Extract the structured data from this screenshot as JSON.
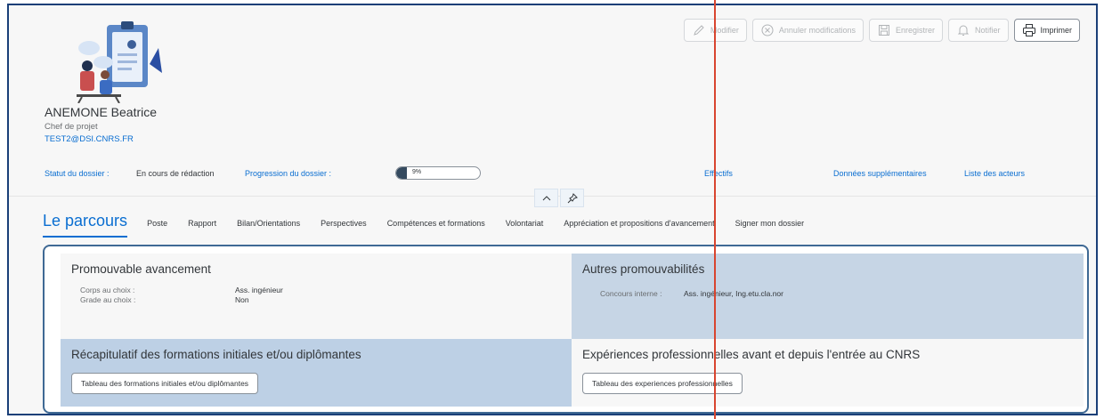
{
  "header": {
    "name": "ANEMONE Beatrice",
    "role": "Chef de projet",
    "email": "TEST2@DSI.CNRS.FR"
  },
  "toolbar": {
    "modifier": "Modifier",
    "annuler": "Annuler modifications",
    "enregistrer": "Enregistrer",
    "notifier": "Notifier",
    "imprimer": "Imprimer"
  },
  "status": {
    "statut_label": "Statut du dossier :",
    "statut_value": "En cours de rédaction",
    "progression_label": "Progression du dossier :",
    "progression_value": "9%",
    "progression_fraction": 0.09,
    "effectifs": "Effectifs",
    "donnees": "Données supplémentaires",
    "acteurs": "Liste des acteurs"
  },
  "tabs": {
    "main": "Le parcours",
    "items": [
      "Poste",
      "Rapport",
      "Bilan/Orientations",
      "Perspectives",
      "Compétences et formations",
      "Volontariat",
      "Appréciation et propositions d'avancement",
      "Signer mon dossier"
    ]
  },
  "sections": {
    "promouvable": {
      "title": "Promouvable avancement",
      "corps_label": "Corps au choix :",
      "corps_value": "Ass. ingénieur",
      "grade_label": "Grade au choix :",
      "grade_value": "Non"
    },
    "autres": {
      "title": "Autres promouvabilités",
      "concours_label": "Concours interne :",
      "concours_value": "Ass. ingénieur, Ing.etu.cla.nor"
    },
    "formations": {
      "title": "Récapitulatif des formations initiales et/ou diplômantes",
      "button": "Tableau des formations initiales et/ou diplômantes"
    },
    "experiences": {
      "title": "Expériences professionnelles avant et depuis l'entrée au CNRS",
      "button": "Tableau des experiences professionnelles"
    }
  },
  "colors": {
    "accent": "#0a6ed1",
    "panel_border": "#3f6994",
    "annotation_line": "#d8452f"
  }
}
